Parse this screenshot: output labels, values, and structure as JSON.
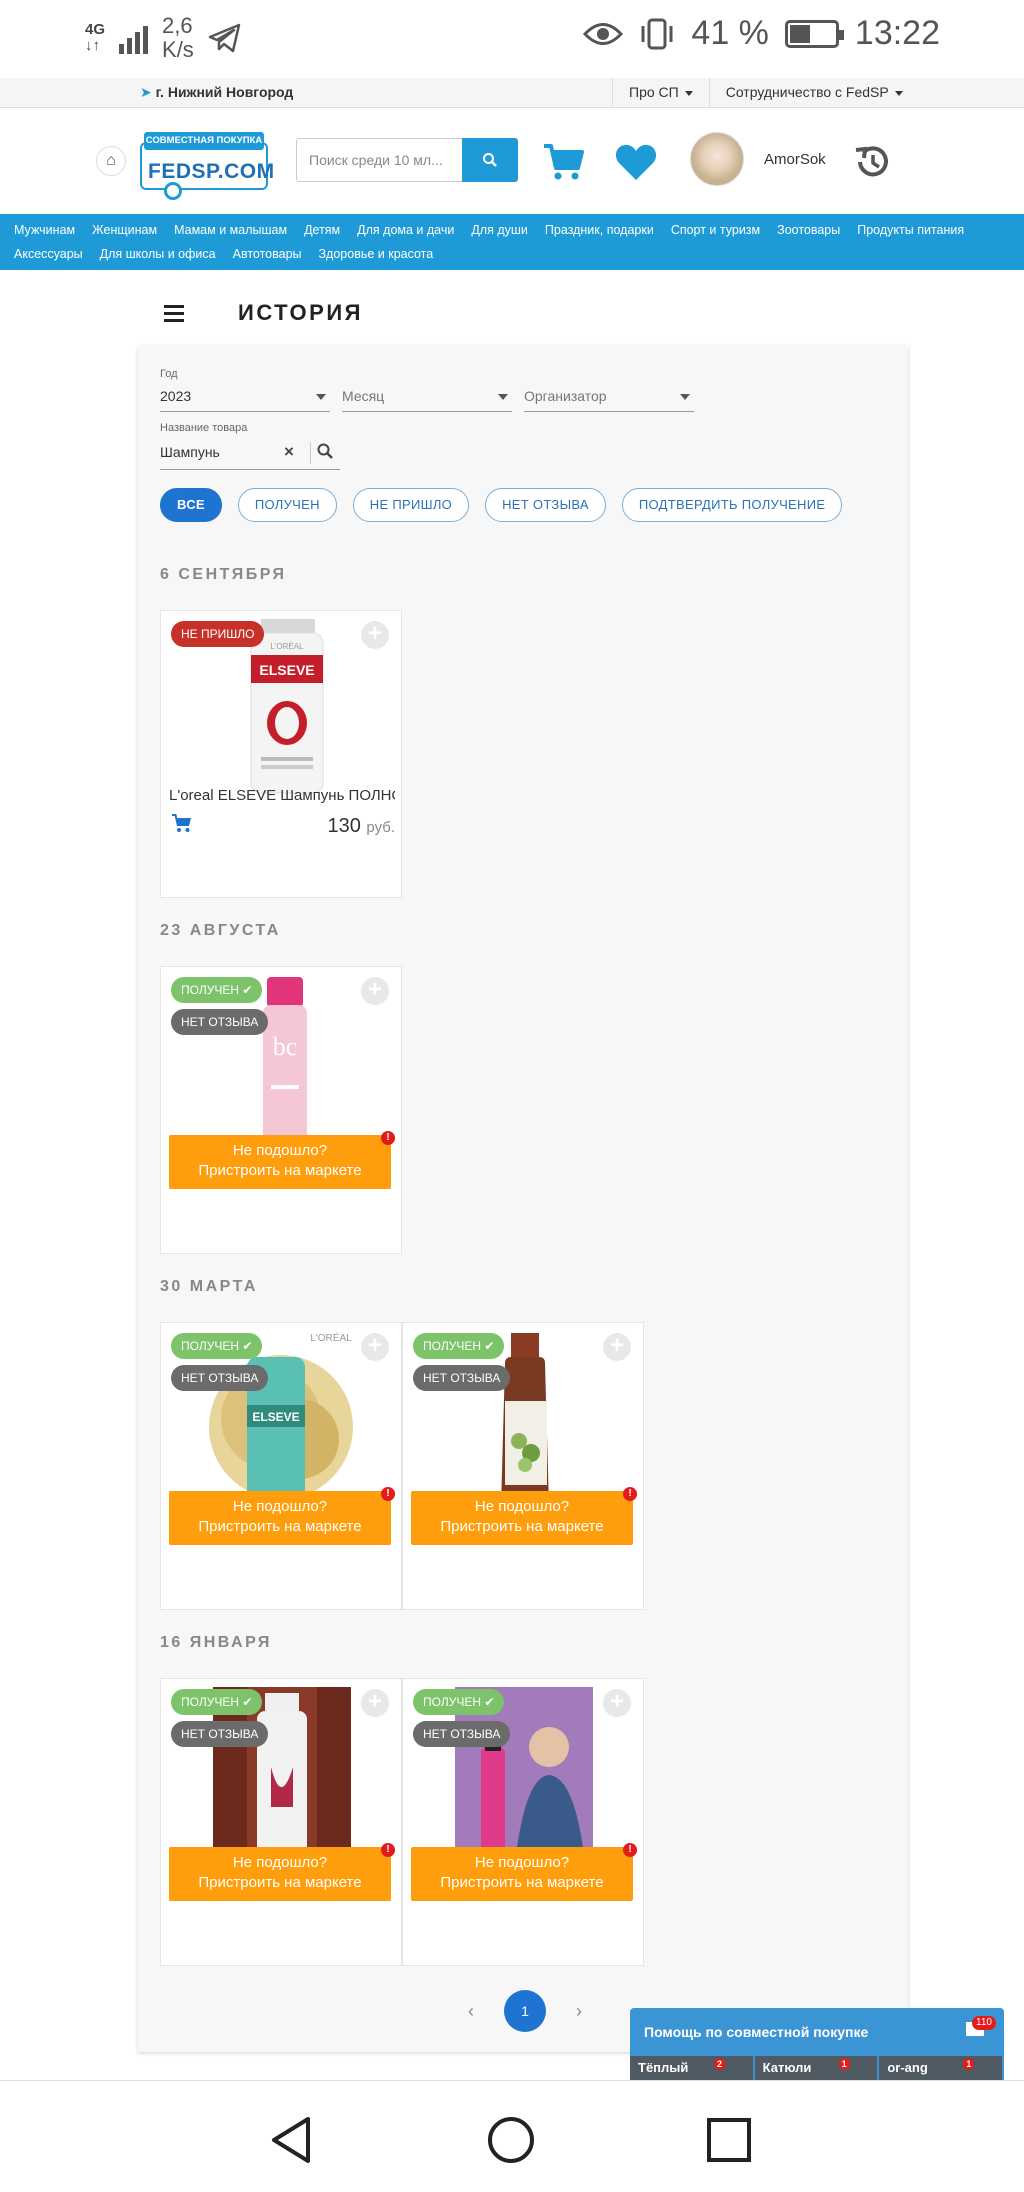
{
  "status_bar": {
    "network": "4G",
    "speed_value": "2,6",
    "speed_unit": "K/s",
    "battery": "41 %",
    "battery_level": 0.41,
    "time": "13:22",
    "icons": [
      "signal-icon",
      "telegram-icon",
      "eye-icon",
      "vibrate-icon",
      "battery-icon"
    ]
  },
  "topbar": {
    "city": "г. Нижний Новгород",
    "menu": [
      "Про СП",
      "Сотрудничество с FedSP"
    ]
  },
  "header": {
    "logo_badge": "СОВМЕСТНАЯ ПОКУПКА",
    "logo_name": "FEDSP.COM",
    "search_placeholder": "Поиск среди 10 мл...",
    "username": "AmorSok",
    "accent_color": "#1e9bd7"
  },
  "categories": [
    "Мужчинам",
    "Женщинам",
    "Мамам и малышам",
    "Детям",
    "Для дома и дачи",
    "Для души",
    "Праздник, подарки",
    "Спорт и туризм",
    "Зоотовары",
    "Продукты питания",
    "Аксессуары",
    "Для школы и офиса",
    "Автотовары",
    "Здоровье и красота"
  ],
  "page": {
    "title": "ИСТОРИЯ"
  },
  "filters": {
    "year_label": "Год",
    "year_value": "2023",
    "month_placeholder": "Месяц",
    "organizer_placeholder": "Организатор",
    "product_label": "Название товара",
    "product_value": "Шампунь"
  },
  "chips": [
    "ВСЕ",
    "ПОЛУЧЕН",
    "НЕ ПРИШЛО",
    "НЕТ ОТЗЫВА",
    "ПОДТВЕРДИТЬ ПОЛУЧЕНИЕ"
  ],
  "groups": [
    {
      "date": "6 СЕНТЯБРЯ",
      "items": [
        {
          "status": "НЕ ПРИШЛО",
          "name": "L'oreal ELSEVE Шампунь ПОЛНОЕ ВОССТАНОВЛЕНИЕ",
          "price": "130",
          "currency": "руб."
        }
      ]
    },
    {
      "date": "23 АВГУСТА",
      "items": [
        {
          "status": "ПОЛУЧЕН",
          "review": "НЕТ ОТЗЫВА",
          "market": [
            "Не подошло?",
            "Пристроить на маркете"
          ],
          "market_badge": "!"
        }
      ]
    },
    {
      "date": "30 МАРТА",
      "items": [
        {
          "status": "ПОЛУЧЕН",
          "review": "НЕТ ОТЗЫВА",
          "market": [
            "Не подошло?",
            "Пристроить на маркете"
          ],
          "market_badge": "!"
        },
        {
          "status": "ПОЛУЧЕН",
          "review": "НЕТ ОТЗЫВА",
          "market": [
            "Не подошло?",
            "Пристроить на маркете"
          ],
          "market_badge": "!"
        }
      ]
    },
    {
      "date": "16 ЯНВАРЯ",
      "items": [
        {
          "status": "ПОЛУЧЕН",
          "review": "НЕТ ОТЗЫВА",
          "market": [
            "Не подошло?",
            "Пристроить на маркете"
          ],
          "market_badge": "!"
        },
        {
          "status": "ПОЛУЧЕН",
          "review": "НЕТ ОТЗЫВА",
          "market": [
            "Не подошло?",
            "Пристроить на маркете"
          ],
          "market_badge": "!"
        }
      ]
    }
  ],
  "pager": {
    "prev": "‹",
    "current": "1",
    "next": "›"
  },
  "help_widget": {
    "title": "Помощь по совместной покупке",
    "count": "110",
    "contacts": [
      {
        "name": "Тёплый",
        "count": "2"
      },
      {
        "name": "Катюли",
        "count": "1"
      },
      {
        "name": "or-ang",
        "count": "1"
      }
    ]
  }
}
